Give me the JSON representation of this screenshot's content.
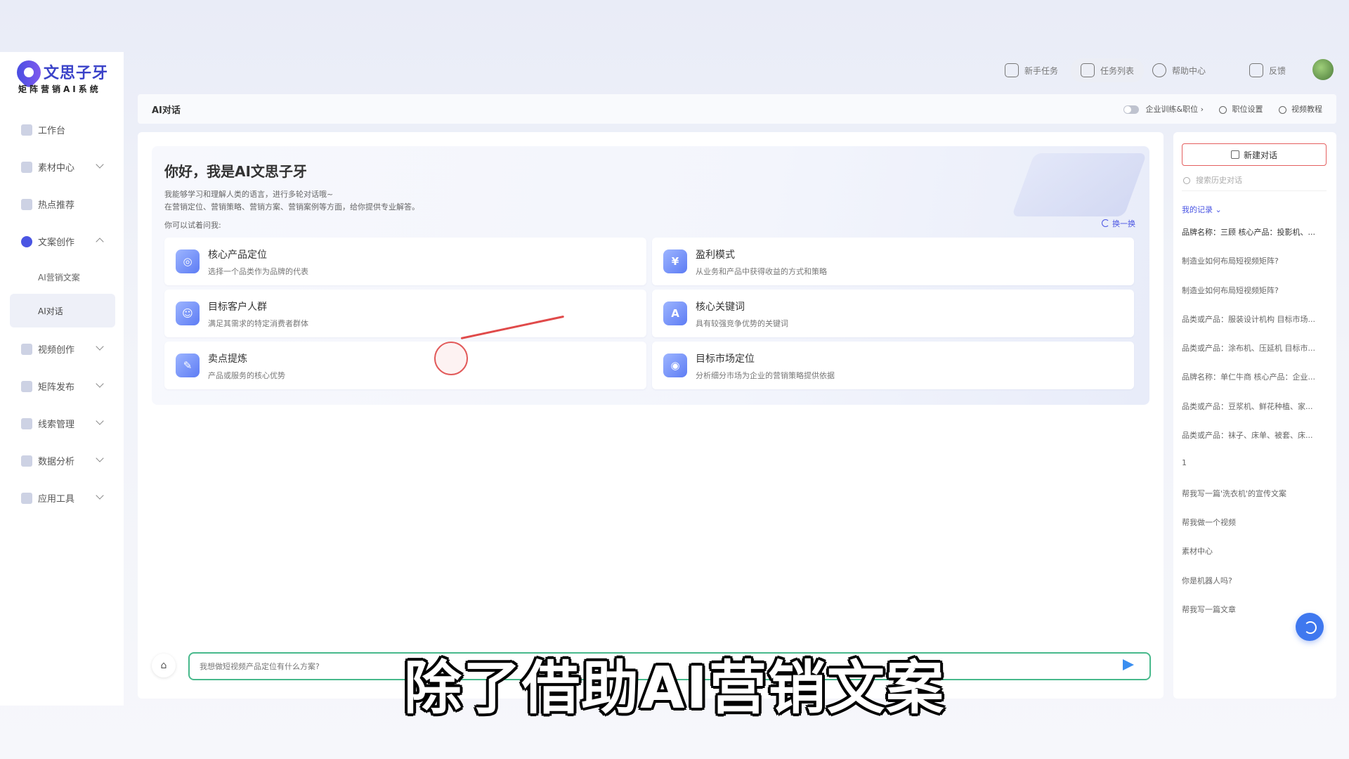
{
  "app": {
    "logo_name": "文思子牙",
    "logo_sub": "矩阵营销AI系统"
  },
  "sidebar": {
    "items": [
      {
        "label": "工作台",
        "chevron": ""
      },
      {
        "label": "素材中心",
        "chevron": "down"
      },
      {
        "label": "热点推荐",
        "chevron": ""
      },
      {
        "label": "文案创作",
        "chevron": "up",
        "active": true
      },
      {
        "label": "视频创作",
        "chevron": "down"
      },
      {
        "label": "矩阵发布",
        "chevron": "down"
      },
      {
        "label": "线索管理",
        "chevron": "down"
      },
      {
        "label": "数据分析",
        "chevron": "down"
      },
      {
        "label": "应用工具",
        "chevron": "down"
      }
    ],
    "sub_items": [
      {
        "label": "AI营销文案"
      },
      {
        "label": "AI对话",
        "selected": true
      }
    ]
  },
  "topbar": {
    "actions": [
      {
        "label": "新手任务",
        "icon": "task-icon"
      },
      {
        "label": "任务列表",
        "icon": "list-icon"
      },
      {
        "label": "帮助中心",
        "icon": "help-icon"
      },
      {
        "label": "反馈",
        "icon": "mail-icon"
      }
    ]
  },
  "crumb": {
    "title": "AI对话",
    "enterprise_toggle": "企业训练&职位",
    "position_settings": "职位设置",
    "video_tutorial": "视频教程"
  },
  "intro": {
    "greeting": "你好，我是AI文思子牙",
    "desc1": "我能够学习和理解人类的语言，进行多轮对话哦~",
    "desc2": "在营销定位、营销策略、营销方案、营销案例等方面，给你提供专业解答。",
    "try_label": "你可以试着问我:",
    "refresh": "换一换"
  },
  "cards": [
    {
      "title": "核心产品定位",
      "sub": "选择一个品类作为品牌的代表",
      "icon": "target-icon",
      "glyph": "◎"
    },
    {
      "title": "盈利模式",
      "sub": "从业务和产品中获得收益的方式和策略",
      "icon": "yen-icon",
      "glyph": "¥"
    },
    {
      "title": "目标客户人群",
      "sub": "满足其需求的特定消费者群体",
      "icon": "people-icon",
      "glyph": "☺"
    },
    {
      "title": "核心关键词",
      "sub": "具有较强竞争优势的关键词",
      "icon": "keyword-icon",
      "glyph": "A"
    },
    {
      "title": "卖点提炼",
      "sub": "产品或服务的核心优势",
      "icon": "pen-icon",
      "glyph": "✎"
    },
    {
      "title": "目标市场定位",
      "sub": "分析细分市场为企业的营销策略提供依据",
      "icon": "radar-icon",
      "glyph": "◉"
    }
  ],
  "input": {
    "placeholder": "我想做短视频产品定位有什么方案?"
  },
  "history": {
    "new_chat": "新建对话",
    "search_placeholder": "搜索历史对话",
    "label": "我的记录",
    "items": [
      "品牌名称：三顾 核心产品：投影机、...",
      "制造业如何布局短视频矩阵?",
      "制造业如何布局短视频矩阵?",
      "品类或产品：服装设计机构 目标市场...",
      "品类或产品：涂布机、压延机 目标市...",
      "品牌名称：单仁牛商 核心产品：企业...",
      "品类或产品：豆浆机、鲜花种植、家...",
      "品类或产品：袜子、床单、被套、床...",
      "1",
      "帮我写一篇'洗衣机'的宣传文案",
      "帮我做一个视频",
      "素材中心",
      "你是机器人吗?",
      "帮我写一篇文章"
    ]
  },
  "subtitle": "除了借助AI营销文案",
  "colors": {
    "accent": "#4a55e3",
    "input_border": "#48b98c",
    "new_chat_border": "#e46060"
  }
}
